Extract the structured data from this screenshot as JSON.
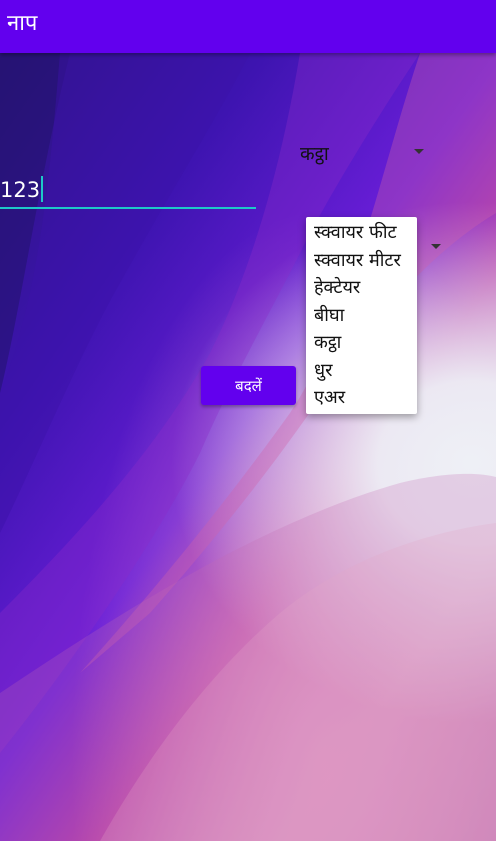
{
  "app_bar": {
    "title": "नाप"
  },
  "from_unit": {
    "selected": "कट्ठा"
  },
  "amount_input": {
    "value": "123"
  },
  "convert_button": {
    "label": "बदलें"
  },
  "to_unit_menu": {
    "options": [
      "स्क्वायर फीट",
      "स्क्वायर मीटर",
      "हेक्टेयर",
      "बीघा",
      "कट्ठा",
      "धुर",
      "एअर"
    ]
  },
  "colors": {
    "primary": "#6200ee",
    "accent": "#1ec8c8"
  },
  "icons": {
    "dropdown": "dropdown-arrow-icon"
  }
}
